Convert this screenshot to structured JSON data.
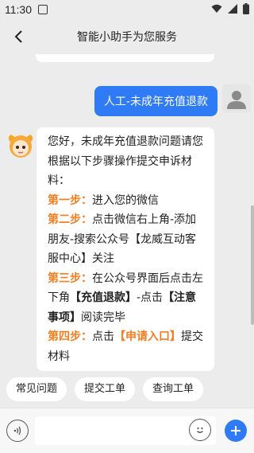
{
  "status_bar": {
    "time": "11:30",
    "icons": [
      "notification-icon",
      "wifi-icon",
      "signal-icon",
      "battery-icon"
    ]
  },
  "header": {
    "title": "智能小助手为您服务"
  },
  "chat": {
    "user_message": "人工-未成年充值退款",
    "bot_message": {
      "intro": "您好，未成年充值退款问题请您根据以下步骤操作提交申诉材料：",
      "steps": [
        {
          "label": "第一步：",
          "text": "进入您的微信"
        },
        {
          "label": "第二步：",
          "text_before": "点击微信右上角-添加朋友-搜索公众号",
          "highlight": "【龙威互动客服中心】",
          "text_after": "关注"
        },
        {
          "label": "第三步：",
          "text_before": "在公众号界面后点击左下角",
          "highlight1": "【充值退款】",
          "mid": "-点击",
          "highlight2": "【注意事项】",
          "text_after": "阅读完毕"
        },
        {
          "label": "第四步：",
          "text_before": "点击",
          "highlight": "【申请入口】",
          "text_after": "提交材料"
        }
      ]
    }
  },
  "quick_replies": [
    "常见问题",
    "提交工单",
    "查询工单"
  ],
  "input": {
    "placeholder": ""
  },
  "colors": {
    "accent": "#2f7bf5",
    "highlight": "#f57d1f",
    "background": "#ececec"
  }
}
